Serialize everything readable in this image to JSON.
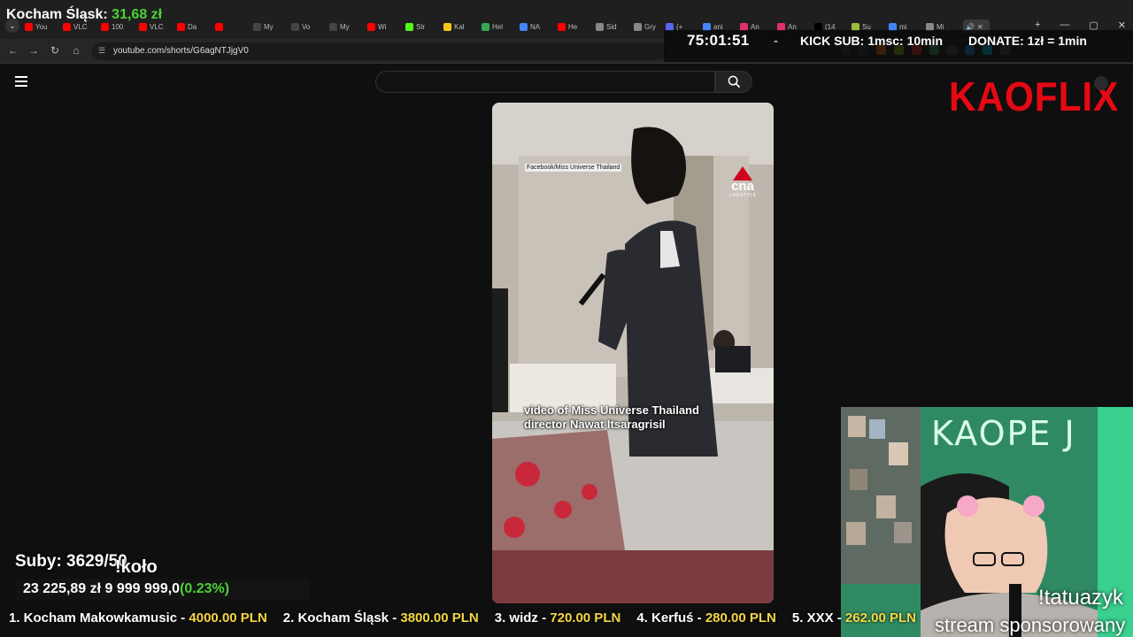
{
  "stream_goal": {
    "label": "Kocham Śląsk:",
    "amount": "31,68 zł"
  },
  "browser": {
    "tabs": [
      {
        "label": "You",
        "color": "#ff0000"
      },
      {
        "label": "VLC",
        "color": "#ff0000"
      },
      {
        "label": "100",
        "color": "#ff0000"
      },
      {
        "label": "VLC",
        "color": "#ff0000"
      },
      {
        "label": "Da",
        "color": "#ff0000"
      },
      {
        "label": "",
        "color": "#ff0000"
      },
      {
        "label": "My",
        "color": "#444444"
      },
      {
        "label": "Vo",
        "color": "#444444"
      },
      {
        "label": "My",
        "color": "#444444"
      },
      {
        "label": "Wi",
        "color": "#ff0000"
      },
      {
        "label": "Str",
        "color": "#53fc18"
      },
      {
        "label": "Kal",
        "color": "#f5c518"
      },
      {
        "label": "Hel",
        "color": "#34a853"
      },
      {
        "label": "NA",
        "color": "#4285f4"
      },
      {
        "label": "He",
        "color": "#ff0000"
      },
      {
        "label": "Sid",
        "color": "#888888"
      },
      {
        "label": "Gry",
        "color": "#888888"
      }
    ],
    "tabs_right": [
      {
        "label": "(+",
        "color": "#5865f2"
      },
      {
        "label": "ani",
        "color": "#4285f4"
      },
      {
        "label": "An",
        "color": "#e1306c"
      },
      {
        "label": "An",
        "color": "#e1306c"
      },
      {
        "label": "(14",
        "color": "#000000"
      },
      {
        "label": "Su",
        "color": "#9bbd3c"
      },
      {
        "label": "mi",
        "color": "#4285f4"
      },
      {
        "label": "Mi",
        "color": "#888888"
      }
    ],
    "active_tab_close": "✕",
    "new_tab": "+",
    "window_controls": [
      "—",
      "▢",
      "✕"
    ],
    "url": "youtube.com/shorts/G6agNTJjgV0",
    "nav": {
      "back": "←",
      "forward": "→",
      "reload": "↻",
      "home": "⌂"
    }
  },
  "stream_overlay": {
    "timer": "75:01:51",
    "separator": "-",
    "kick_sub": "KICK SUB: 1msc: 10min",
    "donate": "DONATE: 1zł = 1min"
  },
  "youtube": {
    "search_placeholder": "",
    "brand": "KAOFLIX"
  },
  "video": {
    "source_tag": "Facebook/Miss Universe Thailand",
    "channel_logo": "cna",
    "channel_logo_sub": "LIFESTYLE",
    "caption": "video of Miss Universe Thailand\ndirector Nawat Itsaragrisil"
  },
  "webcam": {
    "neon_sign": "KAOPE J",
    "subtitle_1": "!tatuazyk",
    "subtitle_2": "stream sponsorowany"
  },
  "stats": {
    "subs": "Suby: 3629/50",
    "kolo": "!koło",
    "money": "23 225,89 zł",
    "money_goal": "9 999 999,0",
    "percent": "(0.23%)"
  },
  "ticker": [
    {
      "label": "1. Kocham Makowkamusic -",
      "amount": "4000.00 PLN"
    },
    {
      "label": "2. Kocham Śląsk -",
      "amount": "3800.00 PLN"
    },
    {
      "label": "3. widz -",
      "amount": "720.00 PLN"
    },
    {
      "label": "4. Kerfuś -",
      "amount": "280.00 PLN"
    },
    {
      "label": "5. XXX -",
      "amount": "262.00 PLN"
    }
  ]
}
